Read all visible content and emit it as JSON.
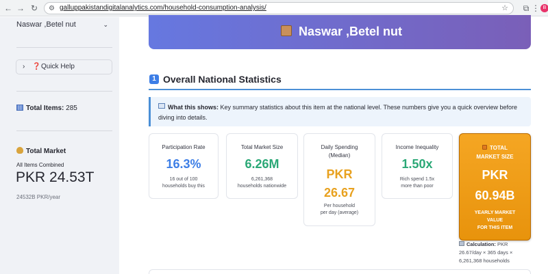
{
  "browser": {
    "url": "galluppakistandigitalanalytics.com/household-consumption-analysis/",
    "profile_initial": "B"
  },
  "sidebar": {
    "selected_item": "Naswar ,Betel nut",
    "quick_help_label": "Quick Help",
    "quick_help_icon": "❓",
    "total_items_label": "Total Items:",
    "total_items_value": "285",
    "total_market_label": "Total Market",
    "all_items_label": "All Items Combined",
    "market_value": "PKR 24.53T",
    "market_per_year": "24532B PKR/year"
  },
  "banner": {
    "title": "Naswar ,Betel nut",
    "icon": "package-icon",
    "gradient": [
      "#6678e0",
      "#7a5fb8"
    ]
  },
  "section": {
    "number": "1",
    "title": "Overall National Statistics"
  },
  "info": {
    "heading": "What this shows:",
    "body": "Key summary statistics about this item at the national level. These numbers give you a quick overview before diving into details."
  },
  "cards": {
    "participation": {
      "label": "Participation Rate",
      "value": "16.3%",
      "sub1": "16 out of 100",
      "sub2": "households buy this",
      "color": "#3d7ee6"
    },
    "market_size": {
      "label": "Total Market Size",
      "value": "6.26M",
      "sub1": "6,261,368",
      "sub2": "households nationwide",
      "color": "#2aa876"
    },
    "daily": {
      "label1": "Daily Spending",
      "label2": "(Median)",
      "value1": "PKR",
      "value2": "26.67",
      "sub1": "Per household",
      "sub2": "per day (average)",
      "color": "#e8a11f"
    },
    "inequality": {
      "label": "Income Inequality",
      "value": "1.50x",
      "sub1": "Rich spend 1.5x",
      "sub2": "more than poor",
      "color": "#2aa876"
    }
  },
  "highlight": {
    "label1": "TOTAL",
    "label2": "MARKET SIZE",
    "value1": "PKR",
    "value2": "60.94B",
    "sub1": "YEARLY MARKET",
    "sub2": "VALUE",
    "sub3": "FOR THIS ITEM",
    "color": "#f5a623"
  },
  "calculation": {
    "label": "Calculation:",
    "text": "PKR 26.67/day × 365 days × 6,261,368 households"
  }
}
